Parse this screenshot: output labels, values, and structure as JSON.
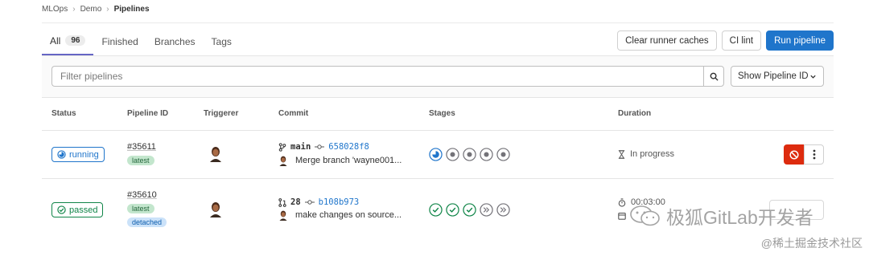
{
  "breadcrumb": {
    "items": [
      "MLOps",
      "Demo",
      "Pipelines"
    ]
  },
  "tabs": [
    {
      "label": "All",
      "count": "96",
      "active": true
    },
    {
      "label": "Finished"
    },
    {
      "label": "Branches"
    },
    {
      "label": "Tags"
    }
  ],
  "actions": {
    "clear_caches": "Clear runner caches",
    "ci_lint": "CI lint",
    "run_pipeline": "Run pipeline"
  },
  "filter": {
    "placeholder": "Filter pipelines",
    "show_id_label": "Show Pipeline ID"
  },
  "table": {
    "headers": {
      "status": "Status",
      "pipeline_id": "Pipeline ID",
      "triggerer": "Triggerer",
      "commit": "Commit",
      "stages": "Stages",
      "duration": "Duration"
    },
    "rows": [
      {
        "status": "running",
        "pipeline_id": "#35611",
        "tags": [
          "latest"
        ],
        "ref": "main",
        "sha": "658028f8",
        "message": "Merge branch 'wayne001...",
        "duration": "In progress"
      },
      {
        "status": "passed",
        "pipeline_id": "#35610",
        "tags": [
          "latest",
          "detached"
        ],
        "ref": "28",
        "sha": "b108b973",
        "message": "make changes on source...",
        "duration": "00:03:00"
      }
    ]
  },
  "watermark": {
    "main": "极狐GitLab开发者",
    "sub": "@稀土掘金技术社区"
  },
  "colors": {
    "primary": "#1f75cb",
    "success": "#108548",
    "danger": "#dd2b0e",
    "active_tab": "#6666c4"
  }
}
